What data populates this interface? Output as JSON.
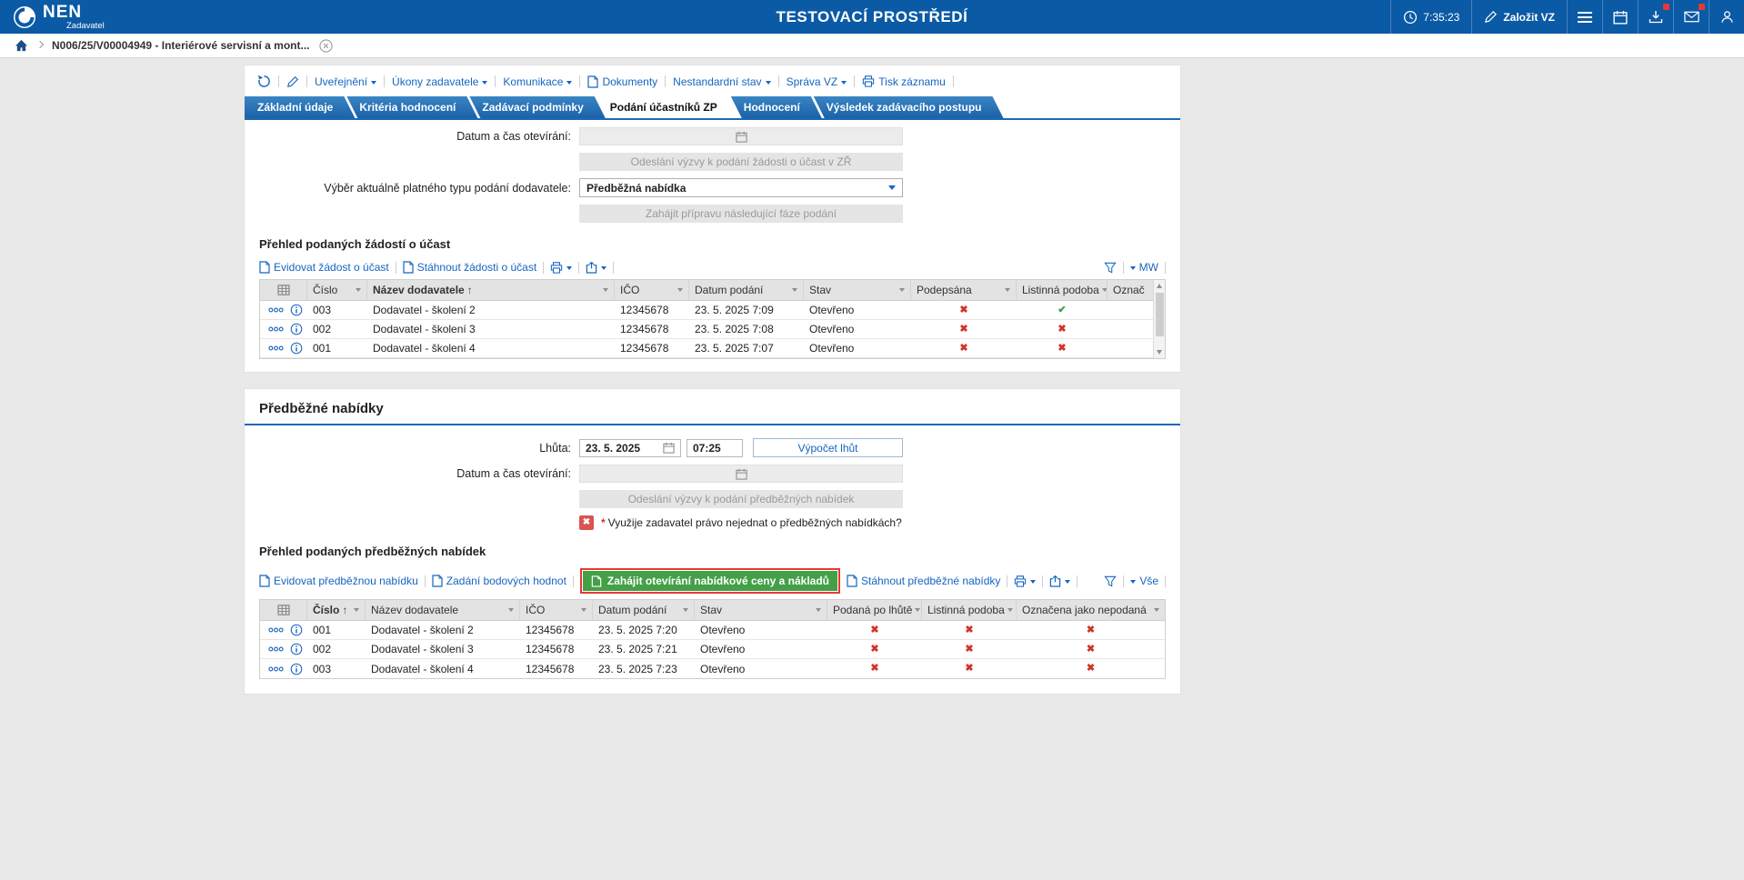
{
  "colors": {
    "accent": "#1565c0",
    "header_bar": "#0b5aa5",
    "green_button": "#43a047",
    "highlight_red": "#e53935",
    "cross_red": "#d0342c",
    "check_green": "#3f9c46"
  },
  "icons": {
    "cross": "✖",
    "check": "✔",
    "sort_up": "↑"
  },
  "header": {
    "logo": "NEN",
    "logo_sub": "Zadavatel",
    "title": "TESTOVACÍ PROSTŘEDÍ",
    "time": "7:35:23",
    "zalozit": "Založit VZ"
  },
  "breadcrumb": {
    "item": "N006/25/V00004949 - Interiérové servisní a mont..."
  },
  "cmdbar": {
    "uverejneni": "Uveřejnění",
    "ukony": "Úkony zadavatele",
    "komunikace": "Komunikace",
    "dokumenty": "Dokumenty",
    "nestandardni": "Nestandardní stav",
    "sprava": "Správa VZ",
    "tisk": "Tisk záznamu"
  },
  "tabs": [
    {
      "label": "Základní údaje"
    },
    {
      "label": "Kritéria hodnocení"
    },
    {
      "label": "Zadávací podmínky"
    },
    {
      "label": "Podání účastníků ZP"
    },
    {
      "label": "Hodnocení"
    },
    {
      "label": "Výsledek zadávacího postupu"
    }
  ],
  "participation": {
    "open_label": "Datum a čas otevírání:",
    "send_btn": "Odeslání výzvy k podání žádosti o účast v ZŘ",
    "type_label": "Výběr aktuálně platného typu podání dodavatele:",
    "type_value": "Předběžná nabídka",
    "next_phase_btn": "Zahájit přípravu následující fáze podání",
    "table_title": "Přehled podaných žádostí o účast",
    "tb_evidovat": "Evidovat žádost o účast",
    "tb_stahnout": "Stáhnout žádosti o účast",
    "filter_value": "MW",
    "col": {
      "cislo": "Číslo",
      "nazev": "Název dodavatele",
      "ico": "IČO",
      "datum": "Datum podání",
      "stav": "Stav",
      "podepsana": "Podepsána",
      "listinna": "Listinná podoba",
      "oznacena": "Označ"
    },
    "rows": [
      {
        "cislo": "003",
        "nazev": "Dodavatel - školení 2",
        "ico": "12345678",
        "datum": "23. 5. 2025 7:09",
        "stav": "Otevřeno"
      },
      {
        "cislo": "002",
        "nazev": "Dodavatel - školení 3",
        "ico": "12345678",
        "datum": "23. 5. 2025 7:08",
        "stav": "Otevřeno"
      },
      {
        "cislo": "001",
        "nazev": "Dodavatel - školení 4",
        "ico": "12345678",
        "datum": "23. 5. 2025 7:07",
        "stav": "Otevřeno"
      }
    ]
  },
  "prelim": {
    "heading": "Předběžné nabídky",
    "lhuta_label": "Lhůta:",
    "lhuta_date": "23. 5. 2025",
    "lhuta_time": "07:25",
    "vypocet_btn": "Výpočet lhůt",
    "open_label": "Datum a čas otevírání:",
    "send_btn": "Odeslání výzvy k podání předběžných nabídek",
    "required_mark": "*",
    "question": "Využije zadavatel právo nejednat o předběžných nabídkách?",
    "table_title": "Přehled podaných předběžných nabídek",
    "tb_evidovat": "Evidovat předběžnou nabídku",
    "tb_zadani": "Zadání bodových hodnot",
    "tb_zahajit": "Zahájit otevírání nabídkové ceny a nákladů",
    "tb_stahnout": "Stáhnout předběžné nabídky",
    "filter_value": "Vše",
    "col": {
      "cislo": "Číslo",
      "nazev": "Název dodavatele",
      "ico": "IČO",
      "datum": "Datum podání",
      "stav": "Stav",
      "podana": "Podaná po lhůtě",
      "listinna": "Listinná podoba",
      "oznacena": "Označena jako nepodaná"
    },
    "rows": [
      {
        "cislo": "001",
        "nazev": "Dodavatel - školení 2",
        "ico": "12345678",
        "datum": "23. 5. 2025 7:20",
        "stav": "Otevřeno"
      },
      {
        "cislo": "002",
        "nazev": "Dodavatel - školení 3",
        "ico": "12345678",
        "datum": "23. 5. 2025 7:21",
        "stav": "Otevřeno"
      },
      {
        "cislo": "003",
        "nazev": "Dodavatel - školení 4",
        "ico": "12345678",
        "datum": "23. 5. 2025 7:23",
        "stav": "Otevřeno"
      }
    ]
  }
}
